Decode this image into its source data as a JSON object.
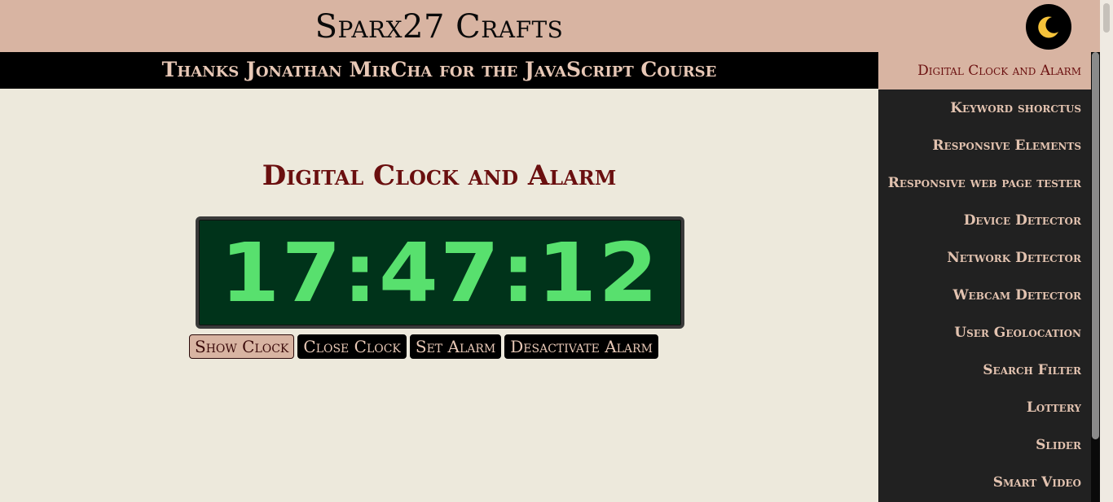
{
  "header": {
    "site_title": "Sparx27 Crafts",
    "theme_toggle_icon": "moon-icon"
  },
  "banner": {
    "text": "Thanks Jonathan MirCha for the JavaScript Course"
  },
  "main": {
    "section_title": "Digital Clock and Alarm",
    "clock_time": "17:47:12",
    "buttons": [
      {
        "label": "Show Clock",
        "active": true
      },
      {
        "label": "Close Clock",
        "active": false
      },
      {
        "label": "Set Alarm",
        "active": false
      },
      {
        "label": "Desactivate Alarm",
        "active": false
      }
    ]
  },
  "menu": {
    "items": [
      {
        "label": "Digital Clock and Alarm",
        "active": true
      },
      {
        "label": "Keyword shorctus"
      },
      {
        "label": "Responsive Elements"
      },
      {
        "label": "Responsive web page tester"
      },
      {
        "label": "Device Detector"
      },
      {
        "label": "Network Detector"
      },
      {
        "label": "Webcam Detector"
      },
      {
        "label": "User Geolocation"
      },
      {
        "label": "Search Filter"
      },
      {
        "label": "Lottery"
      },
      {
        "label": "Slider"
      },
      {
        "label": "Smart Video"
      }
    ]
  },
  "colors": {
    "header_bg": "#d8b4a2",
    "page_bg": "#ede9dc",
    "menu_bg": "#212121",
    "clock_bg": "#00331a",
    "clock_digits": "#58e06e",
    "title_color": "#6a0f0f"
  }
}
